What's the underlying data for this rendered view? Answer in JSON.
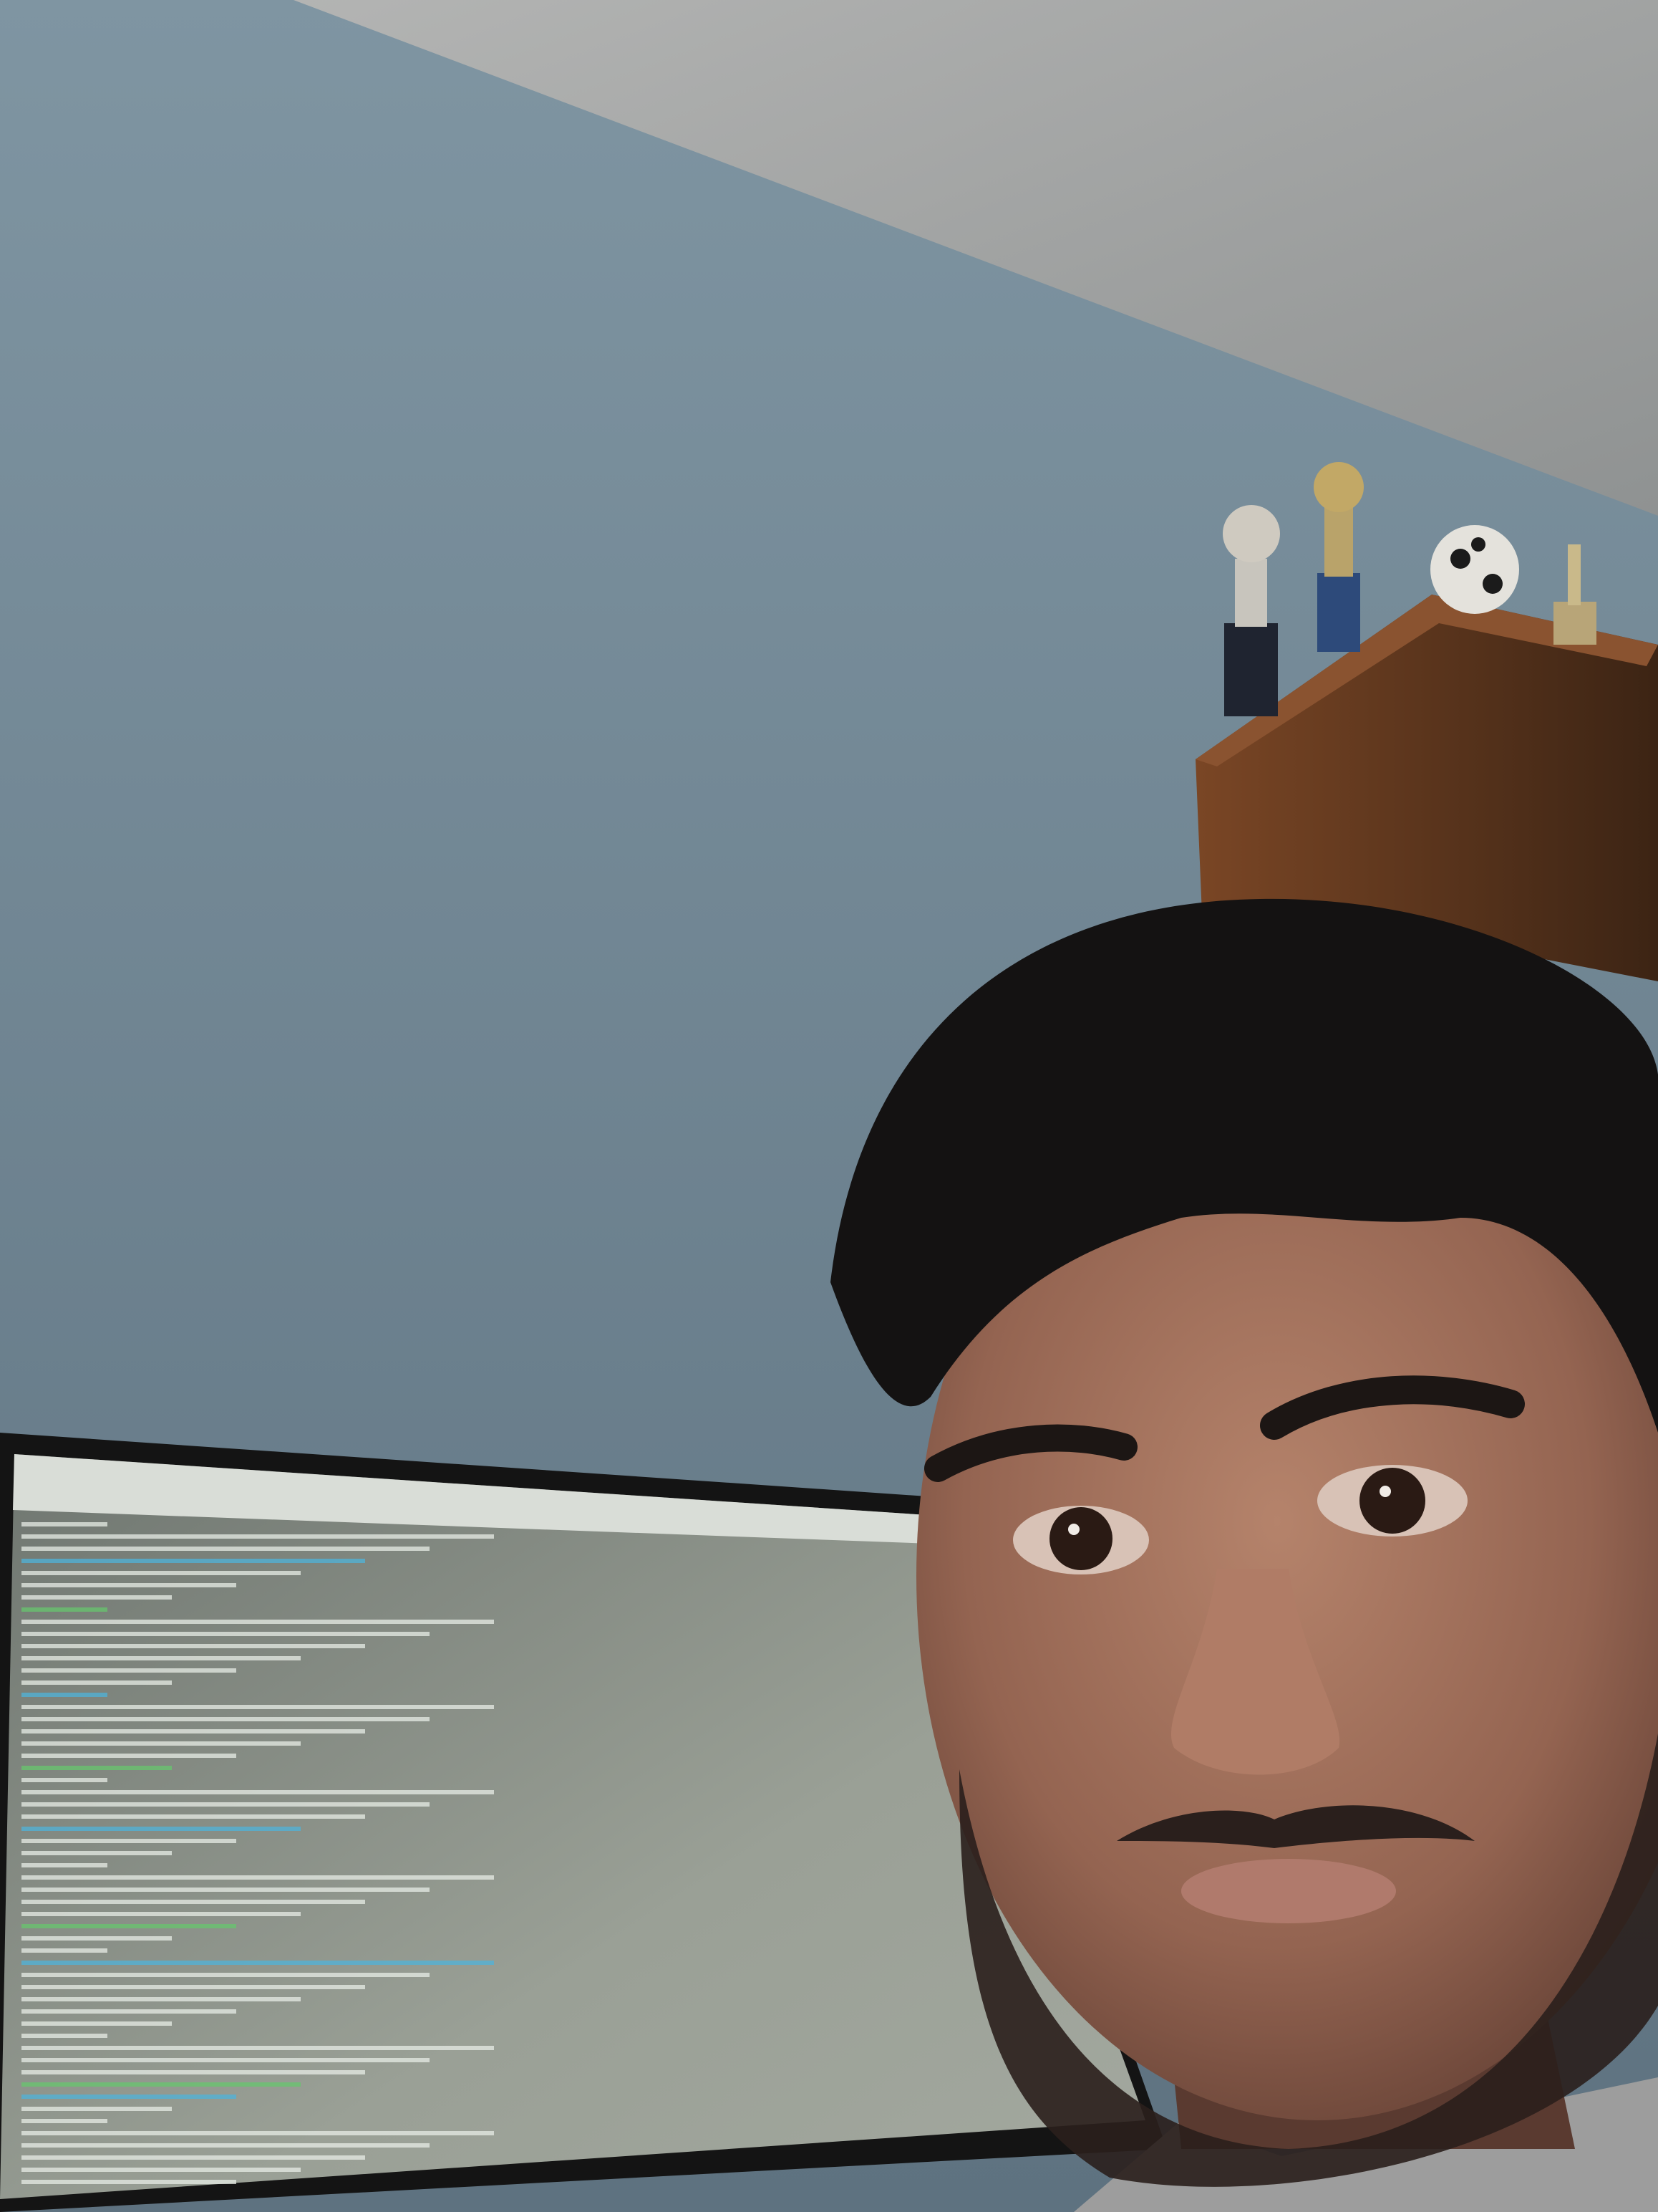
{
  "scene": {
    "colors": {
      "wall_top": "#7f95a2",
      "wall_bottom": "#5f7482",
      "ceiling": "#a8aaaa",
      "monitor_bezel": "#1a1a1a",
      "terminal_bg": "#8f958c",
      "terminal_text": "#e7ece6",
      "terminal_accent_cyan": "#4fb3d9",
      "terminal_accent_green": "#67c56e",
      "shelf": "#6f3f22",
      "hair": "#141212",
      "skin": "#9a6a55",
      "beard": "#2a1f1c",
      "shirt": "#a6a6a6"
    },
    "objects": [
      {
        "name": "wall-background"
      },
      {
        "name": "ceiling"
      },
      {
        "name": "shelf"
      },
      {
        "name": "trophy",
        "count": 4
      },
      {
        "name": "soccer-ball-trophy"
      },
      {
        "name": "monitor"
      },
      {
        "name": "terminal-window"
      },
      {
        "name": "person-face"
      }
    ]
  }
}
